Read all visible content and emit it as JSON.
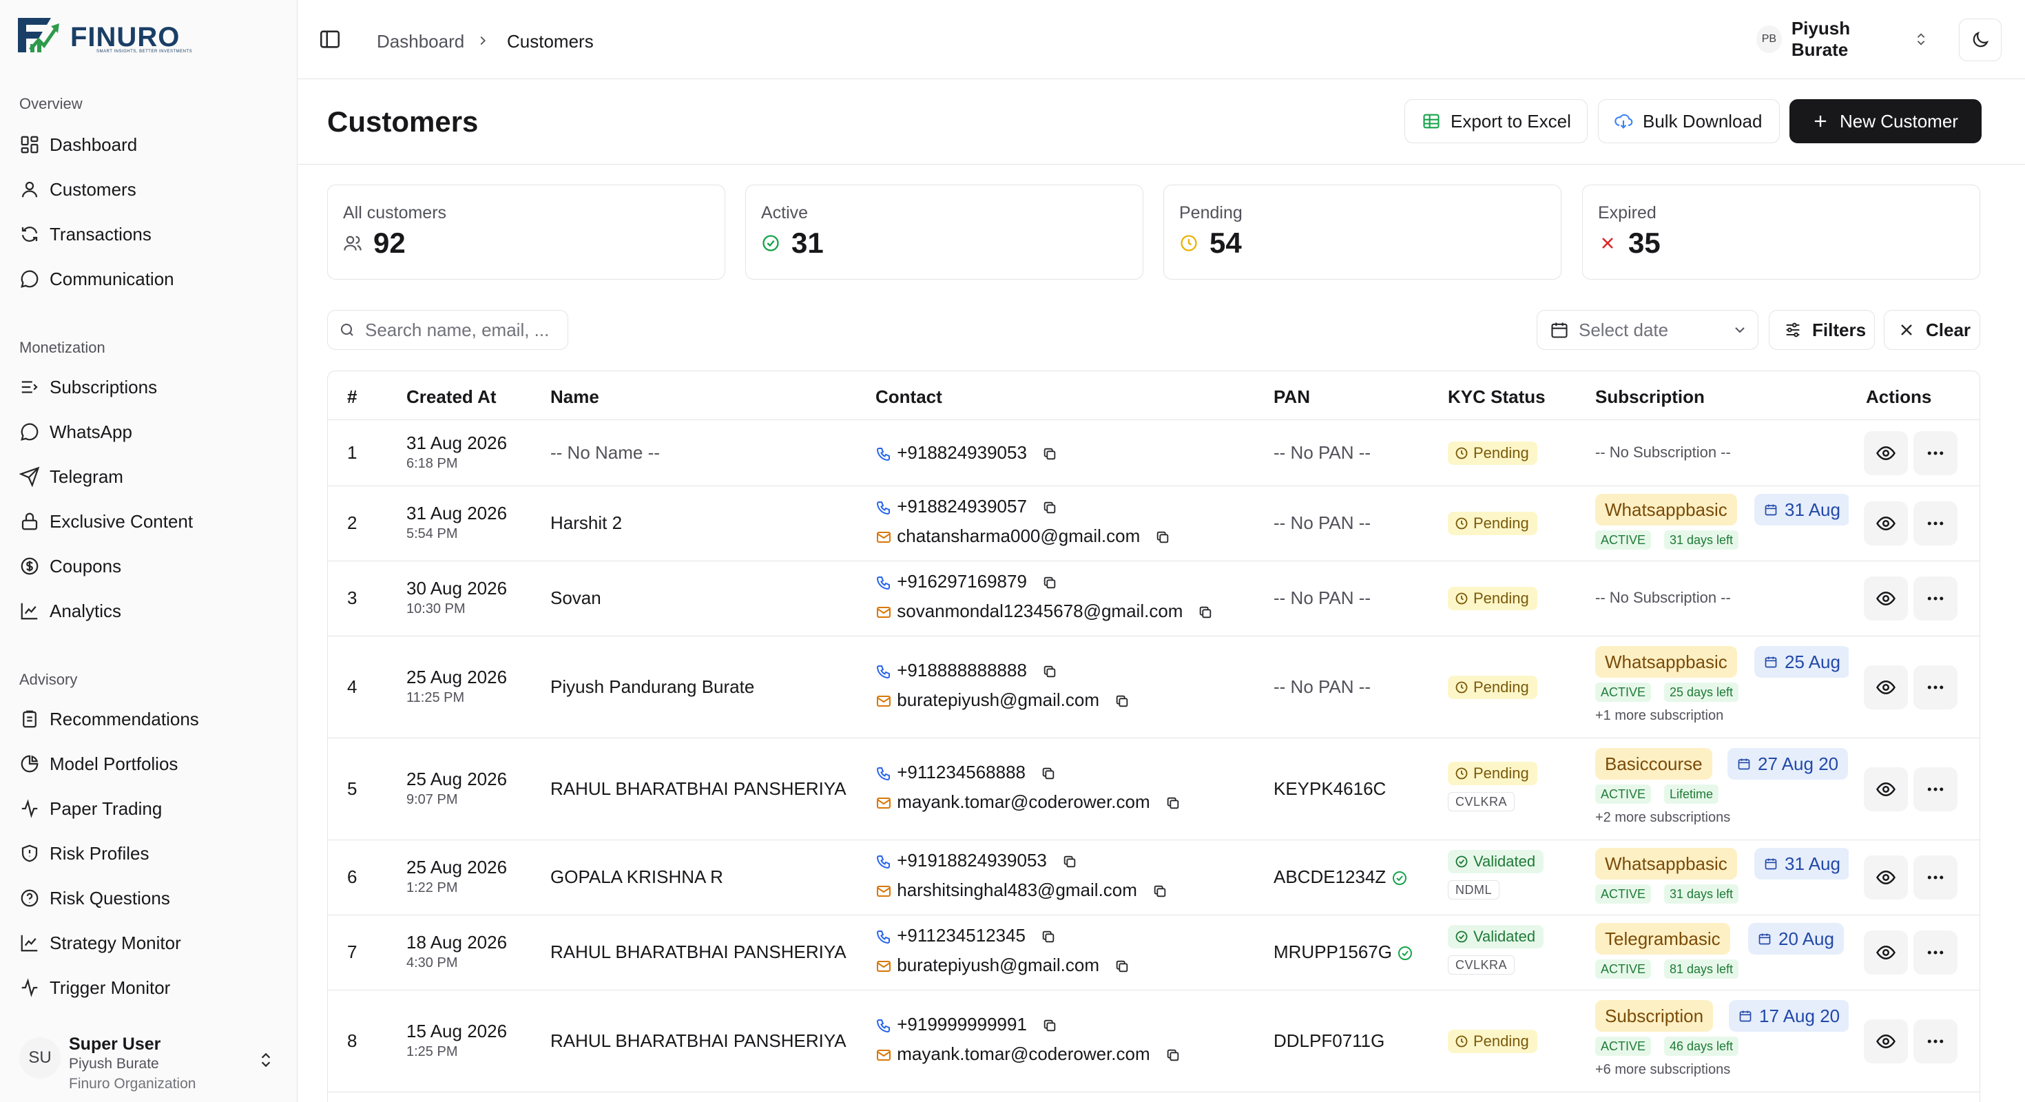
{
  "brand": {
    "name": "FINURO",
    "tagline": "SMART INSIGHTS, BETTER INVESTMENTS"
  },
  "sidebar": {
    "groups": [
      {
        "label": "Overview",
        "items": [
          {
            "label": "Dashboard",
            "icon": "grid-icon"
          },
          {
            "label": "Customers",
            "icon": "user-icon"
          },
          {
            "label": "Transactions",
            "icon": "refresh-icon"
          },
          {
            "label": "Communication",
            "icon": "message-icon"
          }
        ]
      },
      {
        "label": "Monetization",
        "items": [
          {
            "label": "Subscriptions",
            "icon": "list-icon"
          },
          {
            "label": "WhatsApp",
            "icon": "message-icon"
          },
          {
            "label": "Telegram",
            "icon": "send-icon"
          },
          {
            "label": "Exclusive Content",
            "icon": "lock-icon"
          },
          {
            "label": "Coupons",
            "icon": "dollar-icon"
          },
          {
            "label": "Analytics",
            "icon": "chart-icon"
          }
        ]
      },
      {
        "label": "Advisory",
        "items": [
          {
            "label": "Recommendations",
            "icon": "clipboard-icon"
          },
          {
            "label": "Model Portfolios",
            "icon": "pie-icon"
          },
          {
            "label": "Paper Trading",
            "icon": "activity-icon"
          },
          {
            "label": "Risk Profiles",
            "icon": "shield-icon"
          },
          {
            "label": "Risk Questions",
            "icon": "help-icon"
          },
          {
            "label": "Strategy Monitor",
            "icon": "chart-icon"
          },
          {
            "label": "Trigger Monitor",
            "icon": "activity-icon"
          }
        ]
      }
    ],
    "user": {
      "initials": "SU",
      "role": "Super User",
      "name": "Piyush Burate",
      "org": "Finuro Organization"
    }
  },
  "topbar": {
    "breadcrumb": [
      "Dashboard",
      "Customers"
    ],
    "profile": {
      "initials": "PB",
      "name": "Piyush Burate"
    }
  },
  "page": {
    "title": "Customers",
    "buttons": {
      "export": "Export to Excel",
      "bulk": "Bulk Download",
      "new": "New Customer"
    }
  },
  "stats": [
    {
      "label": "All customers",
      "value": "92",
      "icon": "users-icon"
    },
    {
      "label": "Active",
      "value": "31",
      "icon": "check-circle-icon"
    },
    {
      "label": "Pending",
      "value": "54",
      "icon": "clock-icon"
    },
    {
      "label": "Expired",
      "value": "35",
      "icon": "x-icon"
    }
  ],
  "filters": {
    "search_placeholder": "Search name, email, ...",
    "date_placeholder": "Select date",
    "filters_label": "Filters",
    "clear_label": "Clear"
  },
  "table": {
    "columns": [
      "#",
      "Created At",
      "Name",
      "Contact",
      "PAN",
      "KYC Status",
      "Subscription",
      "Actions"
    ],
    "rows": [
      {
        "num": "1",
        "date": "31 Aug 2026",
        "time": "6:18 PM",
        "name": "-- No Name --",
        "phone": "+918824939053",
        "email": "",
        "pan": "-- No PAN --",
        "kyc": "Pending",
        "kyc_source": "",
        "subscription": {
          "none": "-- No Subscription --"
        }
      },
      {
        "num": "2",
        "date": "31 Aug 2026",
        "time": "5:54 PM",
        "name": "Harshit 2",
        "phone": "+918824939057",
        "email": "chatansharma000@gmail.com",
        "pan": "-- No PAN --",
        "kyc": "Pending",
        "kyc_source": "",
        "subscription": {
          "plan": "Whatsappbasic",
          "date": "31 Aug",
          "status": "ACTIVE",
          "remaining": "31 days left",
          "more": ""
        }
      },
      {
        "num": "3",
        "date": "30 Aug 2026",
        "time": "10:30 PM",
        "name": "Sovan",
        "phone": "+916297169879",
        "email": "sovanmondal12345678@gmail.com",
        "pan": "-- No PAN --",
        "kyc": "Pending",
        "kyc_source": "",
        "subscription": {
          "none": "-- No Subscription --"
        }
      },
      {
        "num": "4",
        "date": "25 Aug 2026",
        "time": "11:25 PM",
        "name": "Piyush Pandurang Burate",
        "phone": "+918888888888",
        "email": "buratepiyush@gmail.com",
        "pan": "-- No PAN --",
        "kyc": "Pending",
        "kyc_source": "",
        "subscription": {
          "plan": "Whatsappbasic",
          "date": "25 Aug",
          "status": "ACTIVE",
          "remaining": "25 days left",
          "more": "+1 more subscription"
        }
      },
      {
        "num": "5",
        "date": "25 Aug 2026",
        "time": "9:07 PM",
        "name": "RAHUL BHARATBHAI PANSHERIYA",
        "phone": "+911234568888",
        "email": "mayank.tomar@coderower.com",
        "pan": "KEYPK4616C",
        "kyc": "Pending",
        "kyc_source": "CVLKRA",
        "subscription": {
          "plan": "Basiccourse",
          "date": "27 Aug 20",
          "status": "ACTIVE",
          "remaining": "Lifetime",
          "more": "+2 more subscriptions"
        }
      },
      {
        "num": "6",
        "date": "25 Aug 2026",
        "time": "1:22 PM",
        "name": "GOPALA KRISHNA R",
        "phone": "+91918824939053",
        "email": "harshitsinghal483@gmail.com",
        "pan": "ABCDE1234Z",
        "pan_verified": true,
        "kyc": "Validated",
        "kyc_source": "NDML",
        "subscription": {
          "plan": "Whatsappbasic",
          "date": "31 Aug",
          "status": "ACTIVE",
          "remaining": "31 days left",
          "more": ""
        }
      },
      {
        "num": "7",
        "date": "18 Aug 2026",
        "time": "4:30 PM",
        "name": "RAHUL BHARATBHAI PANSHERIYA",
        "phone": "+911234512345",
        "email": "buratepiyush@gmail.com",
        "pan": "MRUPP1567G",
        "pan_verified": true,
        "kyc": "Validated",
        "kyc_source": "CVLKRA",
        "subscription": {
          "plan": "Telegrambasic",
          "date": "20 Aug",
          "status": "ACTIVE",
          "remaining": "81 days left",
          "more": ""
        }
      },
      {
        "num": "8",
        "date": "15 Aug 2026",
        "time": "1:25 PM",
        "name": "RAHUL BHARATBHAI PANSHERIYA",
        "phone": "+919999999991",
        "email": "mayank.tomar@coderower.com",
        "pan": "DDLPF0711G",
        "kyc": "Pending",
        "kyc_source": "",
        "subscription": {
          "plan": "Subscription",
          "date": "17 Aug 20",
          "status": "ACTIVE",
          "remaining": "46 days left",
          "more": "+6 more subscriptions"
        }
      }
    ]
  },
  "colors": {
    "primary": "#18181b",
    "pending_bg": "#fdf6c9",
    "validated_bg": "#e7f8ea",
    "plan_bg": "#fdf0c4",
    "date_bg": "#e6eefc",
    "active_green": "#1f7a37",
    "phone_blue": "#2563eb",
    "mail_amber": "#d97706"
  }
}
